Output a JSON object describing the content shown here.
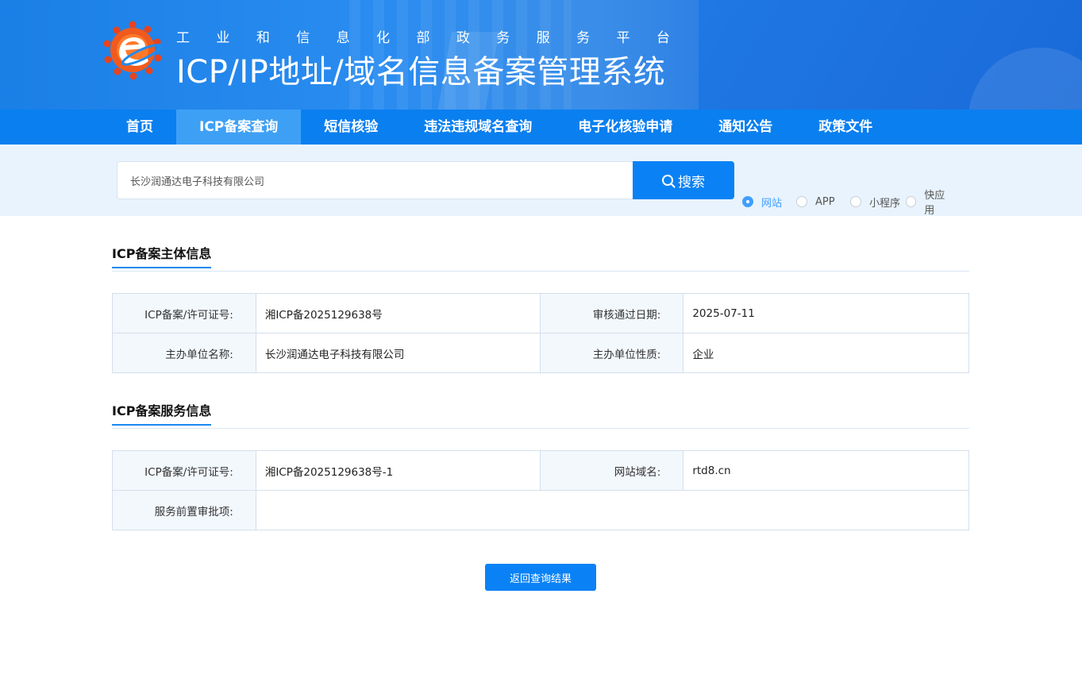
{
  "header": {
    "subtitle_chars": [
      "工",
      "业",
      "和",
      "信",
      "息",
      "化",
      "部",
      "政",
      "务",
      "服",
      "务",
      "平",
      "台"
    ],
    "title": "ICP/IP地址/域名信息备案管理系统"
  },
  "nav": {
    "items": [
      {
        "label": "首页",
        "active": false
      },
      {
        "label": "ICP备案查询",
        "active": true
      },
      {
        "label": "短信核验",
        "active": false
      },
      {
        "label": "违法违规域名查询",
        "active": false
      },
      {
        "label": "电子化核验申请",
        "active": false
      },
      {
        "label": "通知公告",
        "active": false
      },
      {
        "label": "政策文件",
        "active": false
      }
    ]
  },
  "search": {
    "value": "长沙润通达电子科技有限公司",
    "button_label": "搜索",
    "types": [
      {
        "label": "网站",
        "checked": true
      },
      {
        "label": "APP",
        "checked": false
      },
      {
        "label": "小程序",
        "checked": false
      },
      {
        "label": "快应用",
        "checked": false
      }
    ]
  },
  "subject": {
    "title": "ICP备案主体信息",
    "rows": [
      {
        "k1": "ICP备案/许可证号:",
        "v1": "湘ICP备2025129638号",
        "k2": "审核通过日期:",
        "v2": "2025-07-11"
      },
      {
        "k1": "主办单位名称:",
        "v1": "长沙润通达电子科技有限公司",
        "k2": "主办单位性质:",
        "v2": "企业"
      }
    ]
  },
  "service": {
    "title": "ICP备案服务信息",
    "rows": [
      {
        "k1": "ICP备案/许可证号:",
        "v1": "湘ICP备2025129638号-1",
        "k2": "网站域名:",
        "v2": "rtd8.cn"
      }
    ],
    "approval_label": "服务前置审批项:",
    "approval_value": ""
  },
  "back_button": "返回查询结果",
  "colors": {
    "primary": "#0a82f5",
    "nav": "#0a7ff0",
    "nav_active": "#3ea0f5",
    "search_bg": "#e8f3fd"
  }
}
